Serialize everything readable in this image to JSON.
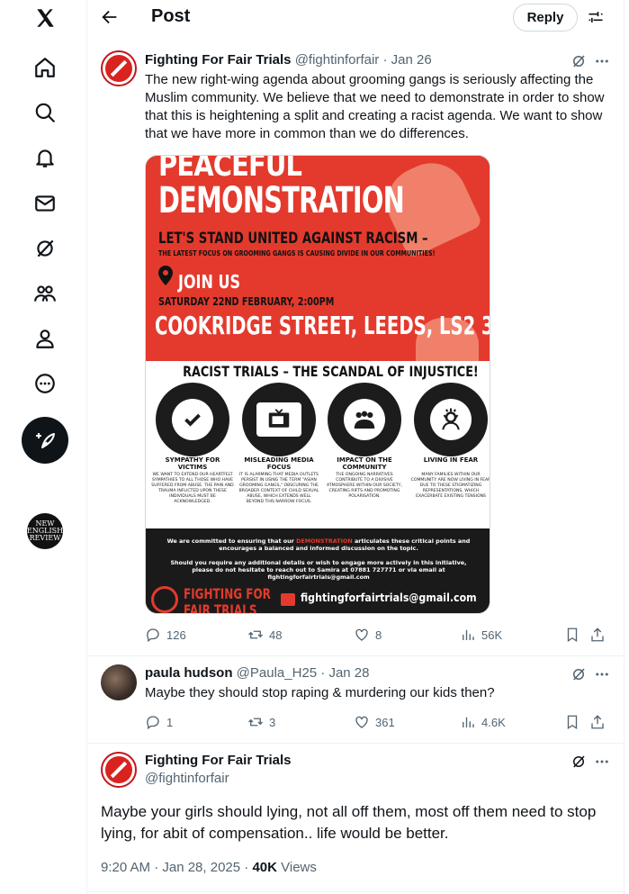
{
  "nav": {
    "items": [
      "x-logo",
      "home",
      "explore",
      "notifications",
      "messages",
      "grok",
      "communities",
      "profile",
      "more"
    ],
    "account_avatar_text": [
      "NEW",
      "ENGLISH",
      "REVIEW"
    ]
  },
  "header": {
    "title": "Post",
    "reply_label": "Reply"
  },
  "main_tweet": {
    "name": "Fighting For Fair Trials",
    "handle": "@fightinforfair",
    "date": "· Jan 26",
    "text": "The new right-wing agenda about grooming gangs is seriously affecting the Muslim community. We believe that we need to demonstrate in order to show that this is heightening a split and creating a racist agenda. We want to show that we have more in common than we do differences.",
    "poster": {
      "title1": "PEACEFUL",
      "title2": "DEMONSTRATION",
      "sub": "LET'S STAND UNITED AGAINST RACISM –",
      "sub2": "THE LATEST FOCUS ON GROOMING GANGS IS CAUSING DIVIDE IN OUR COMMUNITIES!",
      "join": "JOIN US",
      "date": "SATURDAY 22ND FEBRUARY, 2:00PM",
      "street": "COOKRIDGE STREET, LEEDS, LS2 3BA",
      "heading": "RACIST TRIALS – THE SCANDAL OF INJUSTICE!",
      "columns": [
        {
          "title": "SYMPATHY FOR VICTIMS",
          "body": "We want to extend our heartfelt sympathies to all those who have suffered from abuse. The pain and trauma inflicted upon these individuals must be acknowledged."
        },
        {
          "title": "MISLEADING MEDIA FOCUS",
          "body": "It is alarming that media outlets persist in using the term \"Asian grooming gangs,\" obscuring the broader context of child sexual abuse, which extends well beyond this narrow focus."
        },
        {
          "title": "IMPACT ON THE COMMUNITY",
          "body": "The ongoing narratives contribute to a divisive atmosphere within our society, creating rifts and promoting polarisation."
        },
        {
          "title": "LIVING IN FEAR",
          "body": "Many families within our community are now living in fear due to these stigmatizing representations, which exacerbate existing tensions"
        }
      ],
      "bottom1a": "We are committed to ensuring that our",
      "bottom1b": "DEMONSTRATION",
      "bottom1c": "articulates these critical points and encourages a balanced and informed discussion on the topic.",
      "bottom2": "Should you require any additional details or wish to engage more actively in this initiative, please do not hesitate to reach out to Samira at 07881 727771 or via email at fightingforfairtrials@gmail.com",
      "org": "FIGHTING FOR",
      "org2": "FAIR TRIALS",
      "email": "fightingforfairtrials@gmail.com"
    },
    "stats": {
      "replies": "126",
      "reposts": "48",
      "likes": "8",
      "views": "56K"
    }
  },
  "reply_tweet": {
    "name": "paula hudson",
    "handle": "@Paula_H25",
    "date": "· Jan 28",
    "text": "Maybe they should stop raping & murdering our kids then?",
    "stats": {
      "replies": "1",
      "reposts": "3",
      "likes": "361",
      "views": "4.6K"
    }
  },
  "focus_tweet": {
    "name": "Fighting For Fair Trials",
    "handle": "@fightinforfair",
    "text": "Maybe your girls should lying, not all off them, most off them need to stop lying, for abit of compensation.. life would be better.",
    "time": "9:20 AM · Jan 28, 2025 · ",
    "views_count": "40K",
    "views_label": " Views"
  }
}
